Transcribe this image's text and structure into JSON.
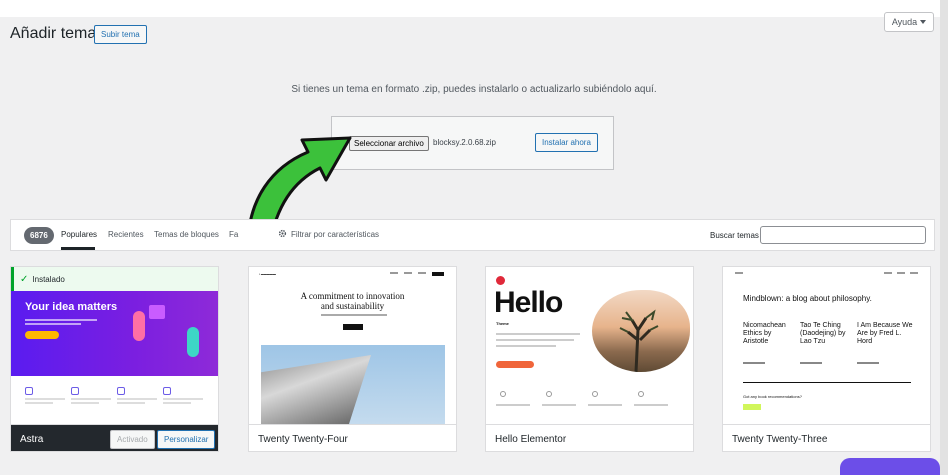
{
  "header": {
    "title": "Añadir temas",
    "upload_button": "Subir tema",
    "help_button": "Ayuda"
  },
  "upload": {
    "message": "Si tienes un tema en formato .zip, puedes instalarlo o actualizarlo subiéndolo aquí.",
    "file_button": "Seleccionar archivo",
    "file_name": "blocksy.2.0.68.zip",
    "install_button": "Instalar ahora"
  },
  "filter": {
    "count": "6876",
    "tabs": [
      "Populares",
      "Recientes",
      "Temas de bloques",
      "Fa"
    ],
    "feature_filter": "Filtrar por características",
    "search_label": "Buscar temas",
    "search_value": ""
  },
  "themes": [
    {
      "name": "Astra",
      "installed_label": "Instalado",
      "activated_button": "Activado",
      "customize_button": "Personalizar",
      "preview_heading": "Your idea matters"
    },
    {
      "name": "Twenty Twenty-Four",
      "preview_heading_1": "A commitment to innovation",
      "preview_heading_2": "and sustainability"
    },
    {
      "name": "Hello Elementor",
      "preview_heading": "Hello",
      "preview_sub": "Theme"
    },
    {
      "name": "Twenty Twenty-Three",
      "preview_heading": "Mindblown: a blog about philosophy.",
      "preview_posts": [
        [
          "Nicomachean",
          "Ethics by",
          "Aristotle"
        ],
        [
          "Tao Te Ching",
          "(Daodejing) by",
          "Lao Tzu"
        ],
        [
          "I Am Because We",
          "Are by Fred L.",
          "Hord"
        ]
      ],
      "preview_question": "Got any book recommendations?"
    }
  ],
  "colors": {
    "accent": "#2271b1",
    "arrow": "#3cc13b",
    "installed": "#00a32a"
  }
}
